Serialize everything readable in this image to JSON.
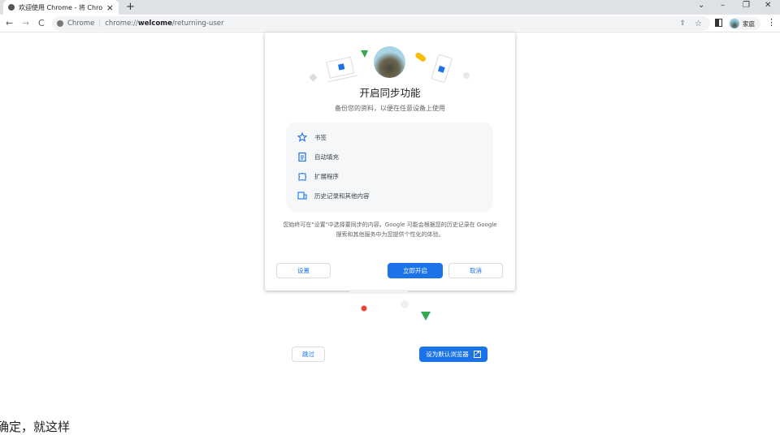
{
  "tab": {
    "title": "欢迎使用 Chrome - 将 Chrome",
    "close": "×",
    "new_tab": "+"
  },
  "window": {
    "chevron": "⌄",
    "minimize": "–",
    "restore": "❐",
    "close": "✕"
  },
  "nav": {
    "back": "←",
    "forward": "→",
    "reload": "C"
  },
  "omnibox": {
    "site": "Chrome",
    "url_prefix": "chrome://",
    "url_bold": "welcome",
    "url_suffix": "/returning-user"
  },
  "profile": {
    "name": "家庭"
  },
  "dialog": {
    "title": "开启同步功能",
    "subtitle": "备份您的资料，以便在任意设备上使用",
    "items": [
      {
        "label": "书签",
        "icon": "star-icon"
      },
      {
        "label": "自动填充",
        "icon": "clipboard-icon"
      },
      {
        "label": "扩展程序",
        "icon": "puzzle-icon"
      },
      {
        "label": "历史记录和其他内容",
        "icon": "devices-icon"
      }
    ],
    "note": "您始终可在\"设置\"中选择要同步的内容。Google 可能会根据您的历史记录在 Google 搜索和其他服务中为您提供个性化的体验。",
    "settings_label": "设置",
    "enable_label": "立即开启",
    "cancel_label": "取消"
  },
  "page": {
    "skip_label": "跳过",
    "default_label": "设为默认浏览器",
    "footer_text": "确定，就这样"
  },
  "colors": {
    "accent": "#1a73e8"
  }
}
